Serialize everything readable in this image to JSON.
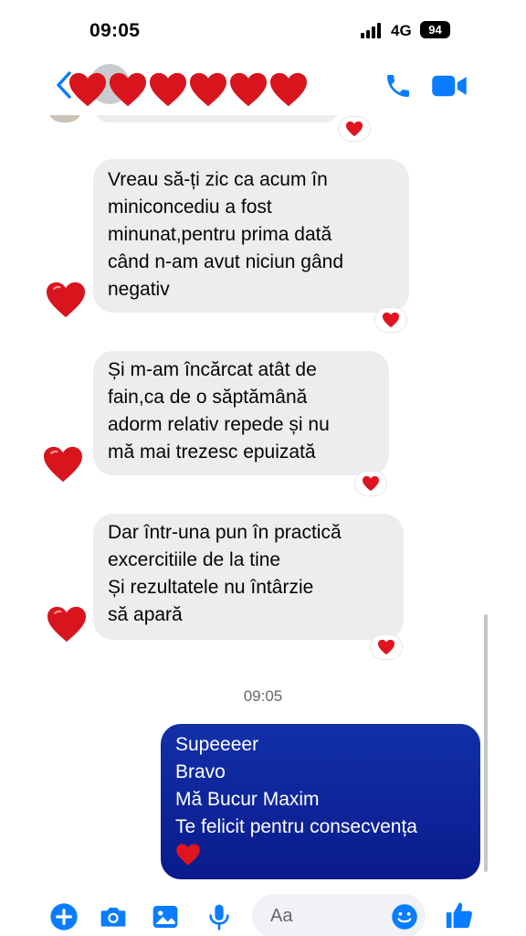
{
  "status_bar": {
    "time": "09:05",
    "network": "4G",
    "battery": "94"
  },
  "header": {
    "contact_name_icon": "row-of-red-hearts",
    "call_icon": "phone-icon",
    "video_icon": "video-camera-icon"
  },
  "messages": {
    "received": [
      {
        "text": "Vreau să-ți zic ca acum în\nminiconcediu a fost\nminunat,pentru prima dată\ncând n-am avut niciun gând\nnegativ"
      },
      {
        "text": "Și m-am încărcat atât de\nfain,ca de o săptămână\nadorm relativ repede și nu\nmă mai trezesc epuizată"
      },
      {
        "text": "Dar într-una pun în practică\nexcercitiile de la tine\nȘi rezultatele nu întârzie\nsă apară"
      }
    ],
    "timestamp": "09:05",
    "sent": {
      "lines": [
        "Supeeeer",
        "Bravo",
        "Mă Bucur Maxim",
        "Te felicit pentru consecvența"
      ]
    }
  },
  "composer": {
    "placeholder": "Aa"
  },
  "colors": {
    "accent": "#0a7cff",
    "sent_bubble": "#0a1b8c",
    "received_bubble": "#ededf0",
    "heart": "#e0141e"
  }
}
